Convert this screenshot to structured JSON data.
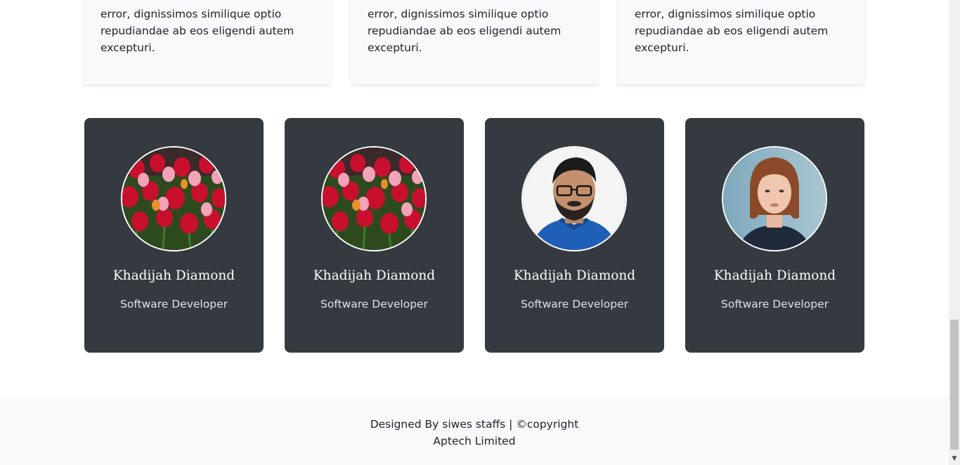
{
  "features": [
    {
      "text": "error, dignissimos similique optio repudiandae ab eos eligendi autem excepturi."
    },
    {
      "text": "error, dignissimos similique optio repudiandae ab eos eligendi autem excepturi."
    },
    {
      "text": "error, dignissimos similique optio repudiandae ab eos eligendi autem excepturi."
    }
  ],
  "team": [
    {
      "name": "Khadijah Diamond",
      "role": "Software Developer",
      "photo": "tulips-photo"
    },
    {
      "name": "Khadijah Diamond",
      "role": "Software Developer",
      "photo": "tulips-photo"
    },
    {
      "name": "Khadijah Diamond",
      "role": "Software Developer",
      "photo": "man-with-glasses-photo"
    },
    {
      "name": "Khadijah Diamond",
      "role": "Software Developer",
      "photo": "red-haired-woman-photo"
    }
  ],
  "footer": {
    "text": "Designed By siwes staffs | ©copyright Aptech Limited"
  },
  "colors": {
    "card_dark": "#343a40",
    "light_bg": "#f8f9fa",
    "text_dark": "#212529"
  }
}
